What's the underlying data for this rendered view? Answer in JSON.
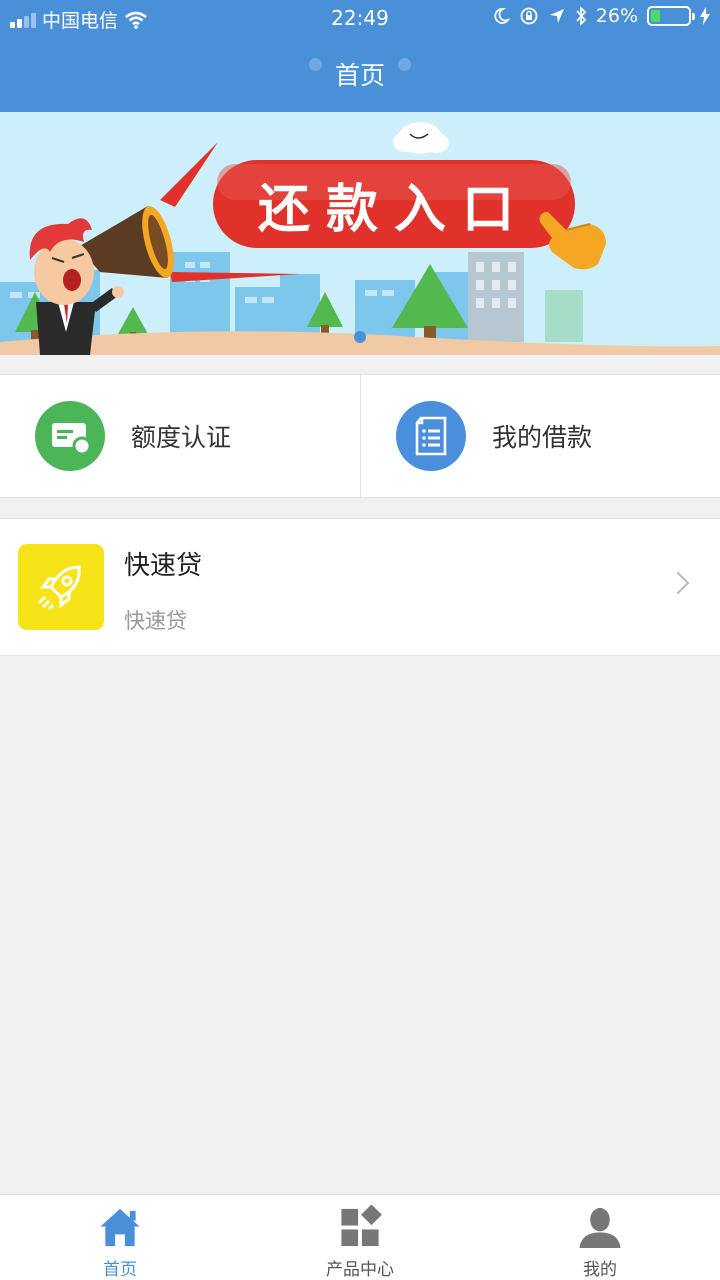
{
  "status_bar": {
    "carrier": "中国电信",
    "time": "22:49",
    "battery_percent": "26%",
    "battery_level": 0.26,
    "icons": [
      "signal-icon",
      "wifi-icon",
      "moon-icon",
      "orientation-lock-icon",
      "location-icon",
      "bluetooth-icon",
      "battery-icon",
      "charging-icon"
    ]
  },
  "nav": {
    "title": "首页"
  },
  "banner": {
    "text": "还款入口",
    "slides": 1,
    "active_slide": 0
  },
  "entries": [
    {
      "label": "额度认证",
      "icon": "credit-card-icon",
      "color": "#4cb558"
    },
    {
      "label": "我的借款",
      "icon": "document-list-icon",
      "color": "#4a8ede"
    }
  ],
  "products": [
    {
      "title": "快速贷",
      "subtitle": "快速贷",
      "icon": "rocket-icon",
      "icon_bg": "#f6e419"
    }
  ],
  "tabbar": {
    "items": [
      {
        "label": "首页",
        "icon": "home-icon",
        "active": true
      },
      {
        "label": "产品中心",
        "icon": "grid-icon",
        "active": false
      },
      {
        "label": "我的",
        "icon": "user-icon",
        "active": false
      }
    ]
  },
  "colors": {
    "primary": "#4a90d9",
    "background": "#f1f1f1",
    "banner_button": "#e0312a"
  }
}
